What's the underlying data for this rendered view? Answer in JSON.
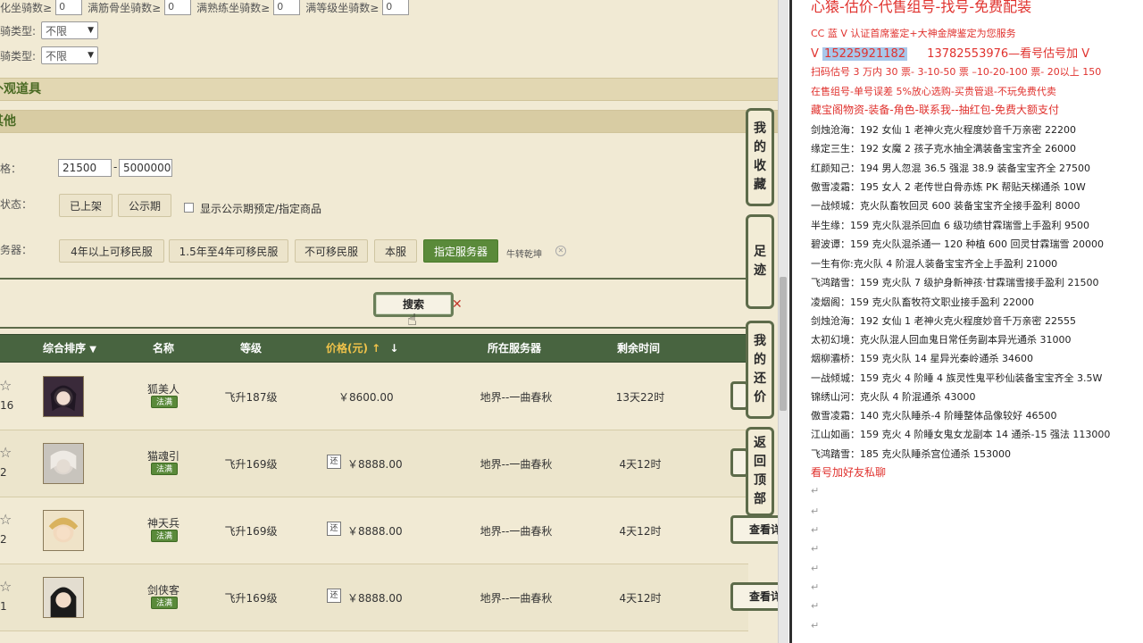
{
  "filters": {
    "attr_row": [
      {
        "label": "化坐骑数≥",
        "value": "0"
      },
      {
        "label": "满筋骨坐骑数≥",
        "value": "0"
      },
      {
        "label": "满熟练坐骑数≥",
        "value": "0"
      },
      {
        "label": "满等级坐骑数≥",
        "value": "0"
      }
    ],
    "mount_type_1": {
      "label": "坐骑类型:",
      "value": "不限"
    },
    "mount_type_2": {
      "label": "坐骑类型:",
      "value": "不限"
    },
    "section_items": "外观道具",
    "section_other": "其他",
    "price": {
      "label": "价格：",
      "min": "21500",
      "max": "5000000"
    },
    "sale_status": {
      "label": "出售状态：",
      "options": [
        "已上架",
        "公示期"
      ],
      "checkbox_label": "显示公示期预定/指定商品"
    },
    "server": {
      "label": "服务器：",
      "options": [
        "4年以上可移民服",
        "1.5年至4年可移民服",
        "不可移民服",
        "本服",
        "指定服务器"
      ],
      "selected": "牛转乾坤"
    }
  },
  "search_label": "搜索",
  "table": {
    "headers": {
      "sort": "综合排序",
      "name": "名称",
      "level": "等级",
      "price": "价格(元)",
      "server": "所在服务器",
      "remain": "剩余时间"
    },
    "rows": [
      {
        "star_count": "16",
        "name": "狐美人",
        "badge": "法满",
        "level": "飞升187级",
        "price": "￥8600.00",
        "server": "地界--一曲春秋",
        "remain": "13天22时",
        "tag": "",
        "view": ""
      },
      {
        "star_count": "2",
        "name": "猫魂引",
        "badge": "法满",
        "level": "飞升169级",
        "price": "￥8888.00",
        "server": "地界--一曲春秋",
        "remain": "4天12时",
        "tag": "还",
        "view": ""
      },
      {
        "star_count": "2",
        "name": "神天兵",
        "badge": "法满",
        "level": "飞升169级",
        "price": "￥8888.00",
        "server": "地界--一曲春秋",
        "remain": "4天12时",
        "tag": "还",
        "view": "查看详"
      },
      {
        "star_count": "1",
        "name": "剑侠客",
        "badge": "法满",
        "level": "飞升169级",
        "price": "￥8888.00",
        "server": "地界--一曲春秋",
        "remain": "4天12时",
        "tag": "还",
        "view": "查看详"
      }
    ]
  },
  "side_tabs": {
    "favorites": [
      "我",
      "的",
      "收",
      "藏"
    ],
    "footprint": [
      "足",
      "迹"
    ],
    "my_bids": [
      "我",
      "的",
      "还",
      "价"
    ],
    "back_top": [
      "返",
      "回",
      "顶",
      "部"
    ]
  },
  "notes": {
    "title": "心猿-估价-代售组号-找号-免费配装",
    "line1": "CC 蓝 V 认证首席鉴定+大神金牌鉴定为您服务",
    "line2_prefix": "V",
    "line2_phone1": "15225921182",
    "line2_rest": "13782553976—看号估号加 V",
    "line3": "扫码估号 3 万内 30 票- 3-10-50 票 –10-20-100 票- 20以上 150",
    "line4": "在售组号-单号误差 5%放心选购-买贵管退-不玩免费代卖",
    "line5": "藏宝阁物资-装备-角色-联系我--抽红包-免费大额支付",
    "items": [
      "剑烛沧海：192 女仙 1 老神火克火程度妙音千万亲密 22200",
      "缘定三生：192 女魔 2 孩子克水抽全满装备宝宝齐全 26000",
      "红颜知己：194 男人忽混 36.5 强混 38.9 装备宝宝齐全 27500",
      "傲雪凌霜：195 女人 2 老传世白骨赤炼 PK 帮贴天梯通杀 10W",
      "一战倾城：克火队畜牧回灵 600 装备宝宝齐全接手盈利 8000",
      "半生缘：159 克火队混杀回血 6 级功绩甘霖瑞雪上手盈利 9500",
      "碧波谭：159 克火队混杀通一 120 种植 600 回灵甘霖瑞雪 20000",
      "一生有你:克火队 4 阶混人装备宝宝齐全上手盈利 21000",
      "飞鸿踏雪：159 克火队 7 级护身新神孩·甘霖瑞雪接手盈利 21500",
      "凌烟阁：159 克火队畜牧符文职业接手盈利 22000",
      "剑烛沧海：192 女仙 1 老神火克火程度妙音千万亲密 22555",
      "太初幻境：克火队混人回血鬼日常任务副本异光通杀 31000",
      "烟柳灞桥：159 克火队 14 星异光秦岭通杀 34600",
      "一战倾城：159 克火 4 阶睡 4 族灵性鬼平秒仙装备宝宝齐全 3.5W",
      "锦绣山河：克火队 4 阶混通杀 43000",
      "傲雪凌霜：140 克火队睡杀-4 阶睡整体品像较好 46500",
      "江山如画：159 克火 4 阶睡女鬼女龙副本 14 通杀-15 强法 113000",
      "飞鸿踏雪：185 克火队睡杀宫位通杀 153000"
    ],
    "footer": "看号加好友私聊",
    "para_mark": "↵"
  },
  "colors": {
    "accent_green": "#486440",
    "price_gold": "#f1c34a",
    "note_red": "#e0322e",
    "badge_green": "#5a8a3a"
  },
  "icons": [
    "star-icon",
    "sort-down-icon",
    "arrow-up-icon",
    "arrow-down-icon",
    "close-icon",
    "cursor-icon"
  ]
}
